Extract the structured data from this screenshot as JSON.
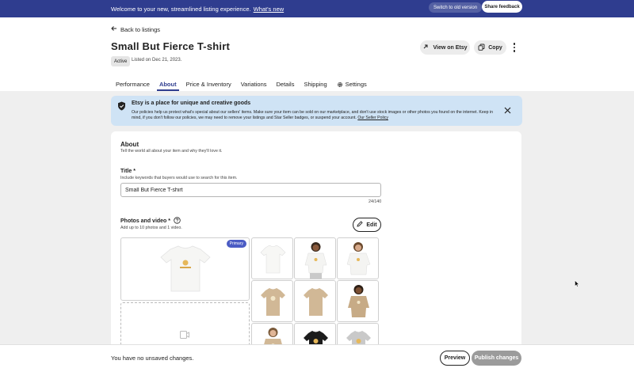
{
  "banner": {
    "message": "Welcome to your new, streamlined listing experience.",
    "link": "What's new",
    "switch_label": "Switch to old version",
    "share_label": "Share feedback"
  },
  "back_link": "Back to listings",
  "listing": {
    "title": "Small But Fierce T-shirt",
    "status": "Active",
    "listed_on": "Listed on Dec 21, 2023."
  },
  "actions": {
    "view_label": "View on Etsy",
    "copy_label": "Copy"
  },
  "tabs": [
    {
      "label": "Performance",
      "active": false
    },
    {
      "label": "About",
      "active": true
    },
    {
      "label": "Price & Inventory",
      "active": false
    },
    {
      "label": "Variations",
      "active": false
    },
    {
      "label": "Details",
      "active": false
    },
    {
      "label": "Shipping",
      "active": false
    },
    {
      "label": "Settings",
      "active": false
    }
  ],
  "info": {
    "heading": "Etsy is a place for unique and creative goods",
    "body": "Our policies help us protect what's special about our sellers' items. Make sure your item can be sold on our marketplace, and don't use stock images or other photos you found on the internet. Keep in mind, if you don't follow our policies, we may need to remove your listings and Star Seller badges, or suspend your account.",
    "link": "Our Seller Policy"
  },
  "about": {
    "heading": "About",
    "subheading": "Tell the world all about your item and why they'll love it.",
    "title_label": "Title *",
    "title_help": "Include keywords that buyers would use to search for this item.",
    "title_value": "Small But Fierce T-shirt",
    "title_counter": "24/140",
    "photos_label": "Photos and video *",
    "photos_help": "Add up to 10 photos and 1 video.",
    "edit_label": "Edit",
    "primary_badge": "Primary"
  },
  "footer": {
    "unsaved": "You have no unsaved changes.",
    "preview_label": "Preview",
    "publish_label": "Publish changes"
  },
  "colors": {
    "brand": "#2f3d8f",
    "info_bg": "#cfe3f5",
    "publish_disabled": "#9b9b9b"
  }
}
